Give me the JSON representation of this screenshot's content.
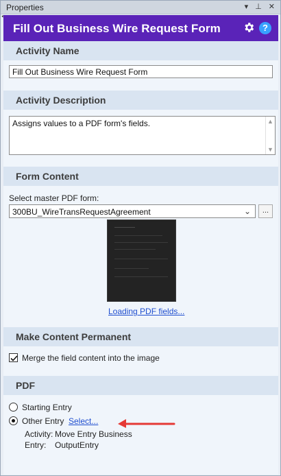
{
  "panel": {
    "title": "Properties",
    "controls": [
      "▾",
      "⊥",
      "✕"
    ]
  },
  "header": {
    "title": "Fill Out Business Wire Request Form"
  },
  "sections": {
    "activity_name": {
      "heading": "Activity Name",
      "value": "Fill Out Business Wire Request Form"
    },
    "activity_description": {
      "heading": "Activity Description",
      "value": "Assigns values to a PDF form's fields."
    },
    "form_content": {
      "heading": "Form Content",
      "select_label": "Select master PDF form:",
      "selected": "300BU_WireTransRequestAgreement",
      "browse_label": "...",
      "loading_link": "Loading PDF fields..."
    },
    "make_permanent": {
      "heading": "Make Content Permanent",
      "checkbox_label": "Merge the field content into the image",
      "checked": true
    },
    "pdf": {
      "heading": "PDF",
      "option_starting": "Starting Entry",
      "option_other": "Other Entry",
      "select_link": "Select...",
      "activity_label": "Activity:",
      "activity_value": "Move Entry Business",
      "entry_label": "Entry:",
      "entry_value": "OutputEntry",
      "selected_option": "Other Entry"
    }
  },
  "colors": {
    "header_bg": "#5a23b8",
    "section_bg": "#d9e4f1",
    "link": "#1f4ecf",
    "arrow": "#e53935"
  },
  "icons": [
    "gear-icon",
    "help-icon",
    "chevron-down-icon",
    "checkmark-icon",
    "arrow-icon"
  ]
}
